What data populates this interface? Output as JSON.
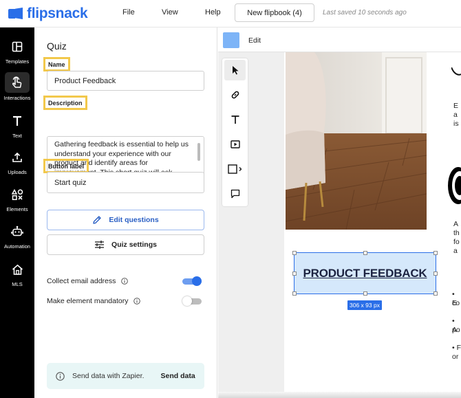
{
  "app": {
    "logo_text": "flipsnack"
  },
  "topbar": {
    "menu": [
      "File",
      "View",
      "Help"
    ],
    "flipbook_button": "New flipbook (4)",
    "saved_status": "Last saved 10 seconds ago"
  },
  "leftnav": {
    "items": [
      {
        "label": "Templates",
        "icon": "templates-icon"
      },
      {
        "label": "Interactions",
        "icon": "interactions-icon",
        "active": true
      },
      {
        "label": "Text",
        "icon": "text-icon"
      },
      {
        "label": "Uploads",
        "icon": "upload-icon"
      },
      {
        "label": "Elements",
        "icon": "elements-icon"
      },
      {
        "label": "Automation",
        "icon": "automation-icon"
      },
      {
        "label": "MLS",
        "icon": "home-icon"
      }
    ]
  },
  "panel": {
    "title": "Quiz",
    "name_label": "Name",
    "name_value": "Product Feedback",
    "description_label": "Description",
    "description_value": "Gathering feedback is essential to help us understand your experience with our product and identify areas for improvement. This short quiz will ask",
    "button_label_label": "Button label",
    "button_label_value": "Start quiz",
    "edit_questions": "Edit questions",
    "quiz_settings": "Quiz settings",
    "collect_email": {
      "label": "Collect email address",
      "on": true
    },
    "mandatory": {
      "label": "Make element mandatory",
      "on": false
    },
    "zapier_text": "Send data with Zapier.",
    "zapier_button": "Send data"
  },
  "editor": {
    "edit_label": "Edit",
    "swatch_color": "#7db4f7",
    "selected_text": "PRODUCT FEEDBACK",
    "dimensions": "306 x 93 px",
    "right_fragments": [
      "E",
      "a",
      "is",
      "A",
      "th",
      "fo",
      "a",
      "• E",
      "co",
      "• A",
      "po",
      "• F",
      "or"
    ]
  },
  "colors": {
    "brand": "#2a6ee8",
    "highlight": "#f2c84b",
    "zapier_bg": "#e8f6f6"
  }
}
